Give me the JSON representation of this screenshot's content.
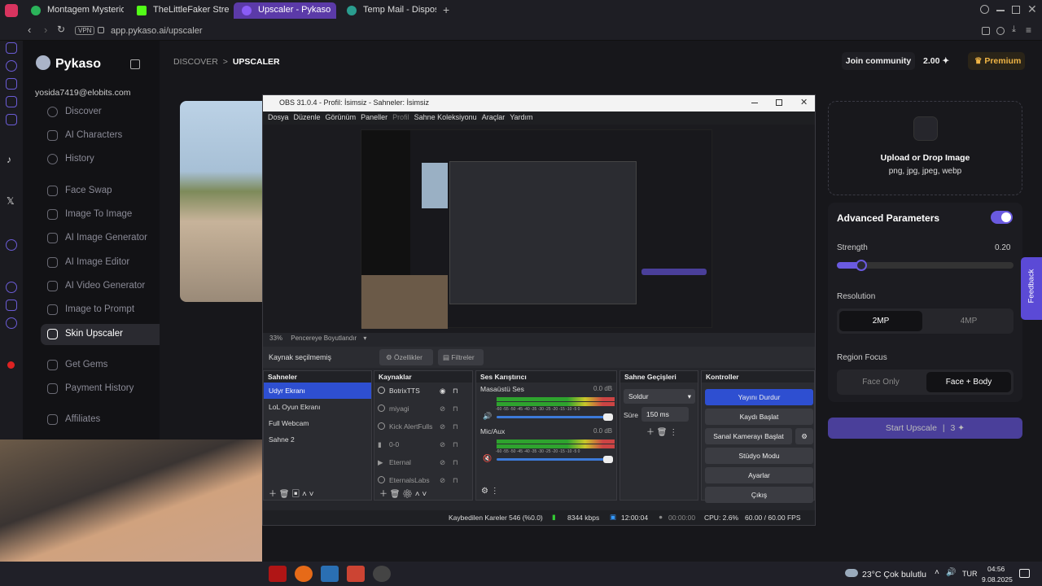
{
  "browser": {
    "tabs": [
      {
        "label": "Montagem Mysterious",
        "color": "#2bb35a"
      },
      {
        "label": "TheLittleFaker Stream - W",
        "color": "#53fc18"
      },
      {
        "label": "Upscaler - Pykaso",
        "color": "#8a5cf6"
      },
      {
        "label": "Temp Mail - Disposable T",
        "color": "#2a9d8f"
      }
    ],
    "new_tab": "+",
    "vpn_badge": "VPN",
    "url": "app.pykaso.ai/upscaler"
  },
  "pykaso": {
    "brand": "Pykaso",
    "email": "yosida7419@elobits.com",
    "nav": [
      {
        "label": "Discover",
        "icon": "compass-icon"
      },
      {
        "label": "AI Characters",
        "icon": "sparkle-icon"
      },
      {
        "label": "History",
        "icon": "clock-icon"
      },
      {
        "label": "Face Swap",
        "icon": "face-icon"
      },
      {
        "label": "Image To Image",
        "icon": "image-icon"
      },
      {
        "label": "AI Image Generator",
        "icon": "wand-icon"
      },
      {
        "label": "AI Image Editor",
        "icon": "edit-icon"
      },
      {
        "label": "AI Video Generator",
        "icon": "video-icon"
      },
      {
        "label": "Image to Prompt",
        "icon": "prompt-icon"
      },
      {
        "label": "Skin Upscaler",
        "icon": "upscale-icon"
      },
      {
        "label": "Get Gems",
        "icon": "gem-icon"
      },
      {
        "label": "Payment History",
        "icon": "receipt-icon"
      },
      {
        "label": "Affiliates",
        "icon": "people-icon"
      }
    ],
    "breadcrumb": {
      "root": "DISCOVER",
      "sep": ">",
      "current": "UPSCALER"
    },
    "header": {
      "join": "Join community",
      "gems": "2.00",
      "premium": "Premium"
    },
    "upload": {
      "title": "Upload or Drop Image",
      "formats": "png, jpg, jpeg, webp"
    },
    "advanced": {
      "title": "Advanced Parameters",
      "strength_label": "Strength",
      "strength_value": "0.20",
      "strength_fraction": 0.2,
      "resolution_label": "Resolution",
      "res_options": [
        "2MP",
        "4MP"
      ],
      "region_label": "Region Focus",
      "region_options": [
        "Face Only",
        "Face + Body"
      ]
    },
    "start": {
      "label": "Start Upscale",
      "sep": "|",
      "cost": "3"
    },
    "feedback": "Feedback"
  },
  "obs": {
    "title": "OBS 31.0.4 - Profil: İsimsiz - Sahneler: İsimsiz",
    "menu": [
      "Dosya",
      "Düzenle",
      "Görünüm",
      "Paneller",
      "Profil",
      "Sahne Koleksiyonu",
      "Araçlar",
      "Yardım"
    ],
    "zoom": "33%",
    "fit": "Pencereye Boyutlandır",
    "no_source": "Kaynak seçilmemiş",
    "props": "Özellikler",
    "filters": "Filtreler",
    "docks": {
      "scenes": "Sahneler",
      "sources": "Kaynaklar",
      "mixer": "Ses Karıştırıcı",
      "transitions": "Sahne Geçişleri",
      "controls": "Kontroller"
    },
    "scenes": [
      "Udyr Ekranı",
      "LoL Oyun Ekranı",
      "Full Webcam",
      "Sahne 2"
    ],
    "sources": [
      "BotrixTTS",
      "miyagi",
      "Kick AlertFulls",
      "0-0",
      "Eternal",
      "EternalsLabs"
    ],
    "mixer": [
      {
        "name": "Masaüstü Ses",
        "db": "0.0 dB"
      },
      {
        "name": "Mic/Aux",
        "db": "0.0 dB"
      }
    ],
    "meter_scale": "-60 -55 -50 -45 -40 -35 -30 -25 -20 -15 -10 -5 0",
    "transition": "Soldur",
    "duration_label": "Süre",
    "duration": "150 ms",
    "controls": [
      "Yayını Durdur",
      "Kaydı Başlat",
      "Sanal Kamerayı Başlat",
      "Stüdyo Modu",
      "Ayarlar",
      "Çıkış"
    ],
    "status": {
      "dropped": "Kaybedilen Kareler 546 (%0.0)",
      "bitrate": "8344 kbps",
      "live": "12:00:04",
      "rec": "00:00:00",
      "cpu": "CPU: 2.6%",
      "fps": "60.00 / 60.00 FPS"
    }
  },
  "taskbar": {
    "weather": "23°C  Çok bulutlu",
    "lang": "TUR",
    "time": "04:56",
    "date": "9.08.2025"
  }
}
